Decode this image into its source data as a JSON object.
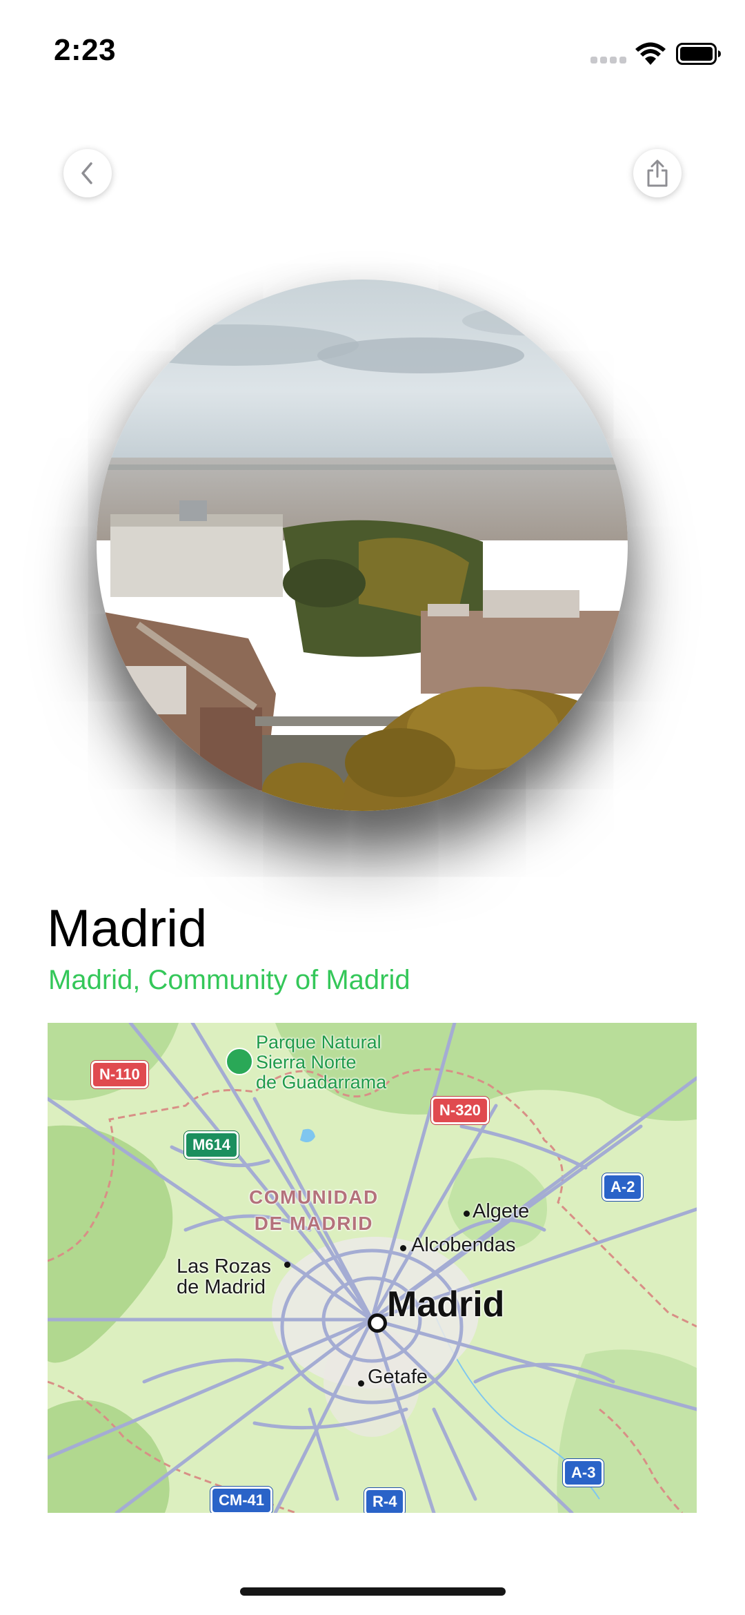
{
  "status_bar": {
    "time": "2:23",
    "icons": [
      "cellular-signal-icon",
      "wifi-icon",
      "battery-icon"
    ]
  },
  "nav": {
    "back_icon": "chevron-left-icon",
    "share_icon": "share-icon"
  },
  "hero": {
    "image_description": "aerial-city-photo"
  },
  "place": {
    "title": "Madrid",
    "subtitle": "Madrid, Community of Madrid"
  },
  "map": {
    "park_label": "Parque Natural\nSierra Norte\nde Guadarrama",
    "region_label": "COMUNIDAD\nDE MADRID",
    "cities": {
      "madrid": "Madrid",
      "alcobendas": "Alcobendas",
      "algete": "Algete",
      "las_rozas": "Las Rozas\nde Madrid",
      "getafe": "Getafe"
    },
    "road_shields": {
      "n110": "N-110",
      "n320": "N-320",
      "m614": "M614",
      "a2": "A-2",
      "a3": "A-3",
      "cm41": "CM-41",
      "r4": "R-4"
    }
  },
  "colors": {
    "accent_green": "#34c759",
    "map_land": "#d9ecbd",
    "map_forest": "#b6dc98",
    "map_roads": "#a4acd3"
  }
}
